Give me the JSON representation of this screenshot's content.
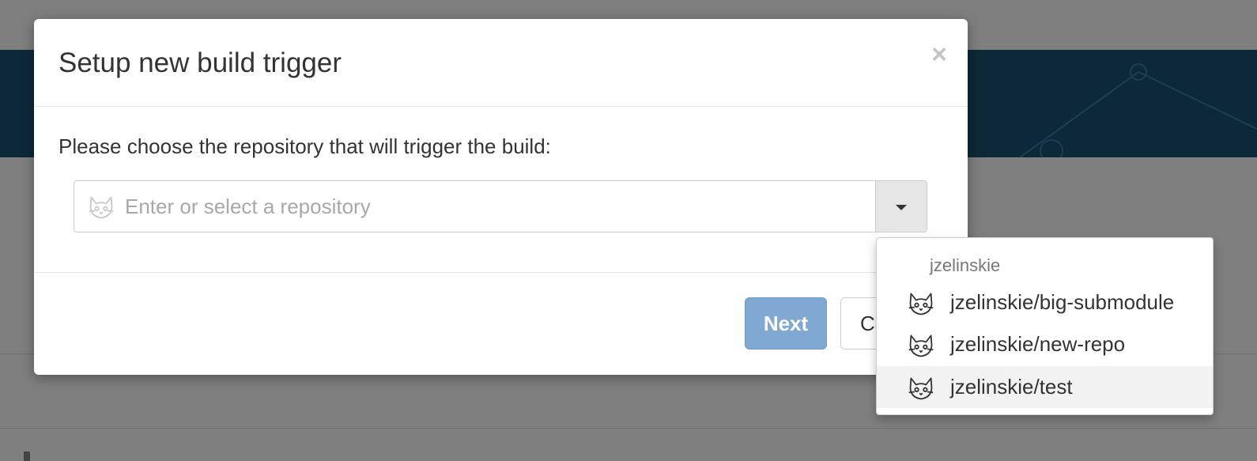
{
  "modal": {
    "title": "Setup new build trigger",
    "close_glyph": "×",
    "prompt": "Please choose the repository that will trigger the build:",
    "repo_input": {
      "value": "",
      "placeholder": "Enter or select a repository",
      "icon": "gitlab-icon"
    },
    "buttons": {
      "next_label": "Next",
      "cancel_label": "Ca"
    }
  },
  "dropdown": {
    "header": "jzelinskie",
    "items": [
      {
        "label": "jzelinskie/big-submodule",
        "icon": "gitlab-icon"
      },
      {
        "label": "jzelinskie/new-repo",
        "icon": "gitlab-icon"
      },
      {
        "label": "jzelinskie/test",
        "icon": "gitlab-icon",
        "highlighted": true
      }
    ]
  },
  "colors": {
    "overlay": "#7f7f7f",
    "header_band": "#0d2839",
    "primary_button": "#7fa9d3",
    "highlight": "#f2f2f2"
  }
}
